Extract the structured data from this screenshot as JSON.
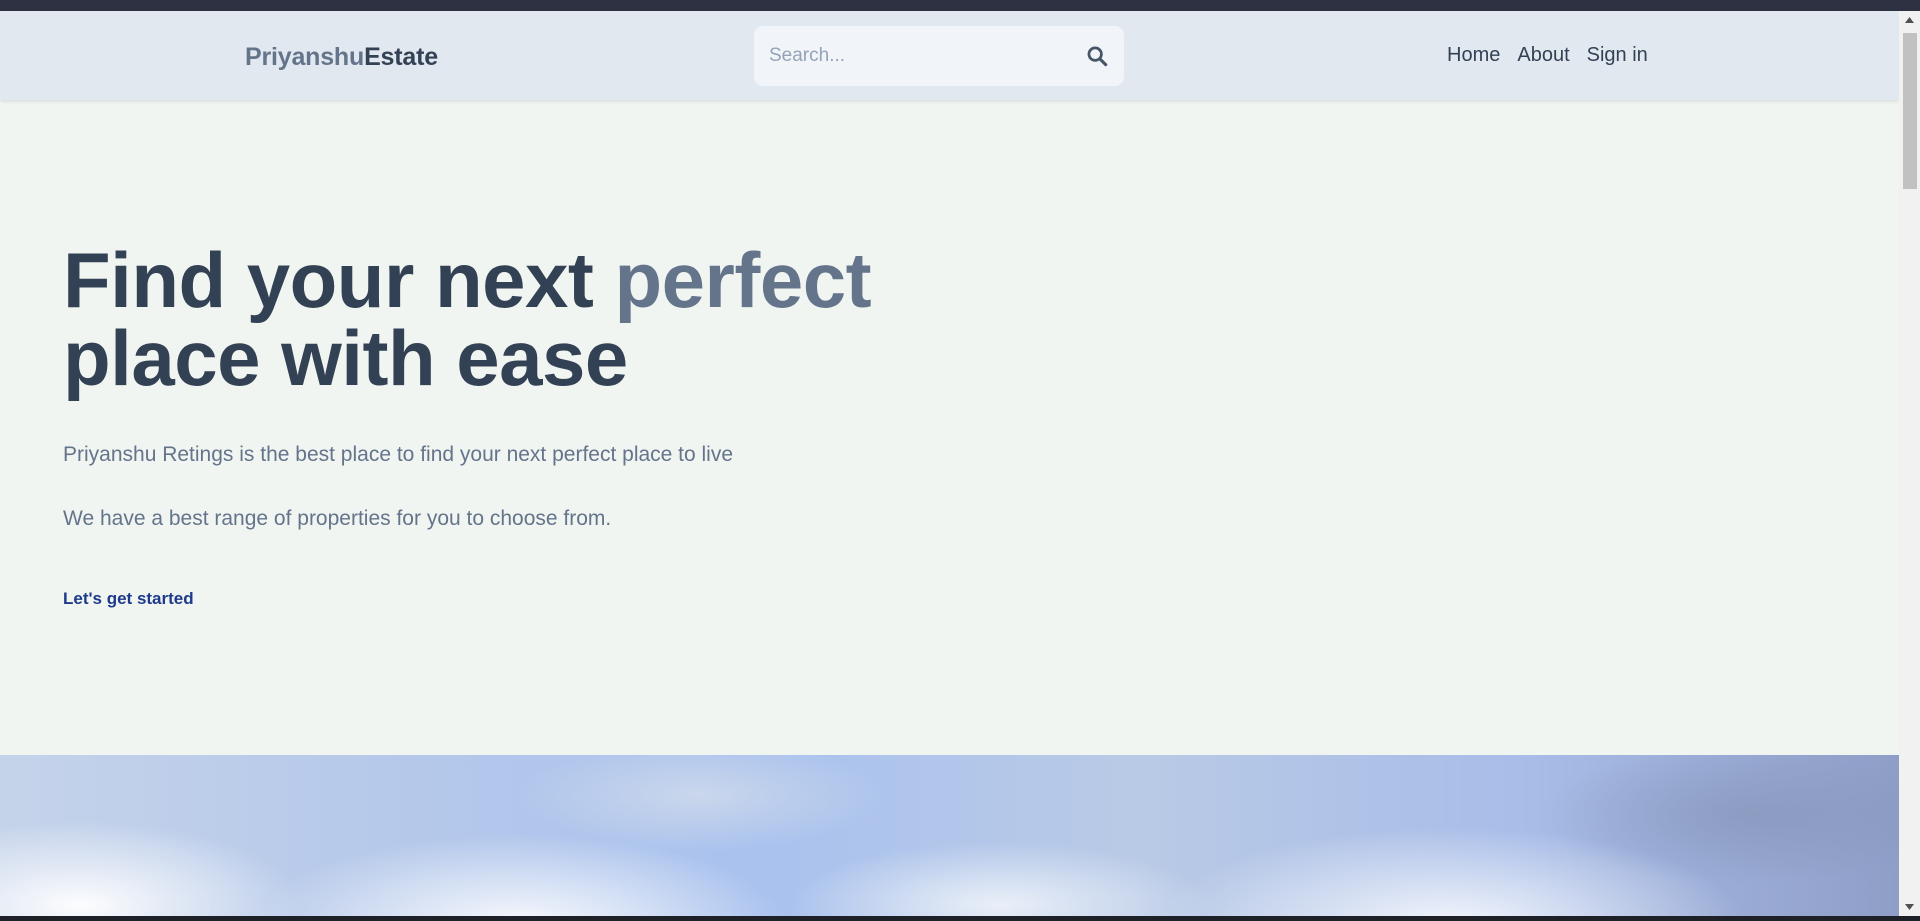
{
  "header": {
    "logo_part1": "Priyanshu",
    "logo_part2": "Estate",
    "search": {
      "placeholder": "Search..."
    },
    "nav": [
      {
        "label": "Home"
      },
      {
        "label": "About"
      },
      {
        "label": "Sign in"
      }
    ]
  },
  "hero": {
    "title_part1": "Find your next ",
    "title_highlight": "perfect",
    "title_part2": "place with ease",
    "description_line1": "Priyanshu Retings is the best place to find your next perfect place to live",
    "description_line2": "We have a best range of properties for you to choose from.",
    "cta_label": "Let's get started"
  },
  "icons": {
    "search": "search-icon",
    "scroll_up": "scroll-up-arrow-icon",
    "scroll_down": "scroll-down-arrow-icon"
  },
  "colors": {
    "header_bg": "#e2e8f0",
    "page_bg": "#f1f5f1",
    "text_dark": "#334155",
    "text_muted": "#64748b",
    "cta": "#1e3a8a"
  }
}
